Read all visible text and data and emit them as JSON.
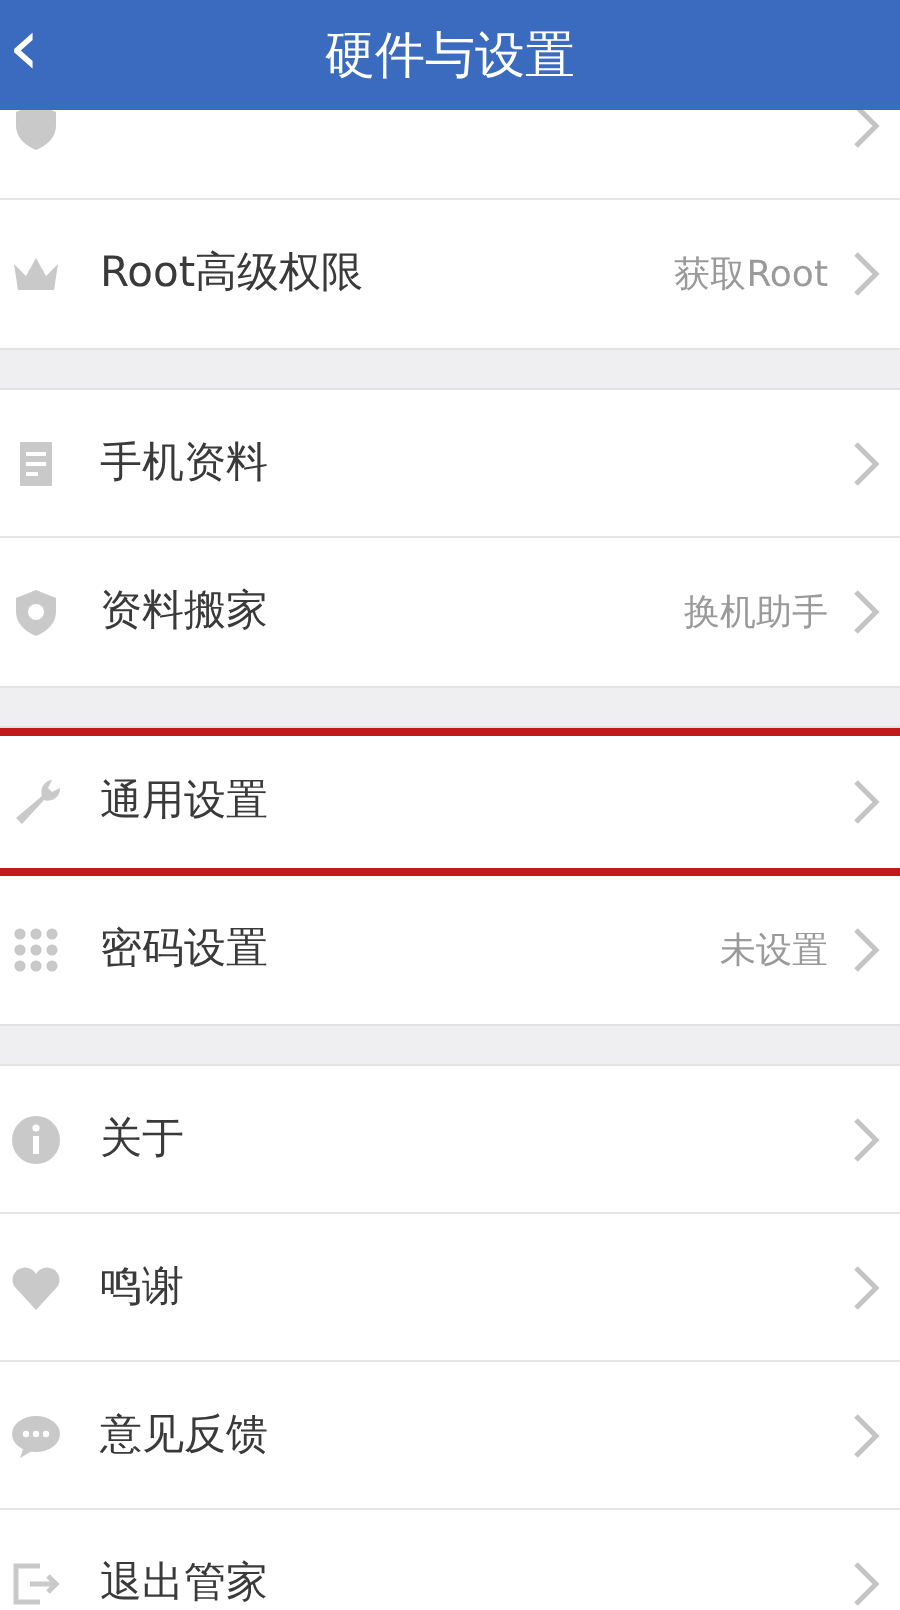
{
  "header": {
    "title": "硬件与设置",
    "back": "‹"
  },
  "groups": [
    {
      "items": [
        {
          "kind": "shield",
          "highlighted": false
        },
        {
          "kind": "crown",
          "label": "Root高级权限",
          "value": "获取Root",
          "highlighted": false
        }
      ]
    },
    {
      "items": [
        {
          "kind": "document",
          "label": "手机资料",
          "highlighted": false
        },
        {
          "kind": "badge",
          "label": "资料搬家",
          "value": "换机助手",
          "highlighted": false
        }
      ]
    },
    {
      "items": [
        {
          "kind": "wrench",
          "label": "通用设置",
          "highlighted": true
        },
        {
          "kind": "keypad",
          "label": "密码设置",
          "value": "未设置",
          "highlighted": false
        }
      ]
    },
    {
      "items": [
        {
          "kind": "info",
          "label": "关于",
          "highlighted": false
        },
        {
          "kind": "heart",
          "label": "鸣谢",
          "highlighted": false
        },
        {
          "kind": "chat",
          "label": "意见反馈",
          "highlighted": false
        },
        {
          "kind": "exit",
          "label": "退出管家",
          "highlighted": false
        }
      ]
    }
  ]
}
